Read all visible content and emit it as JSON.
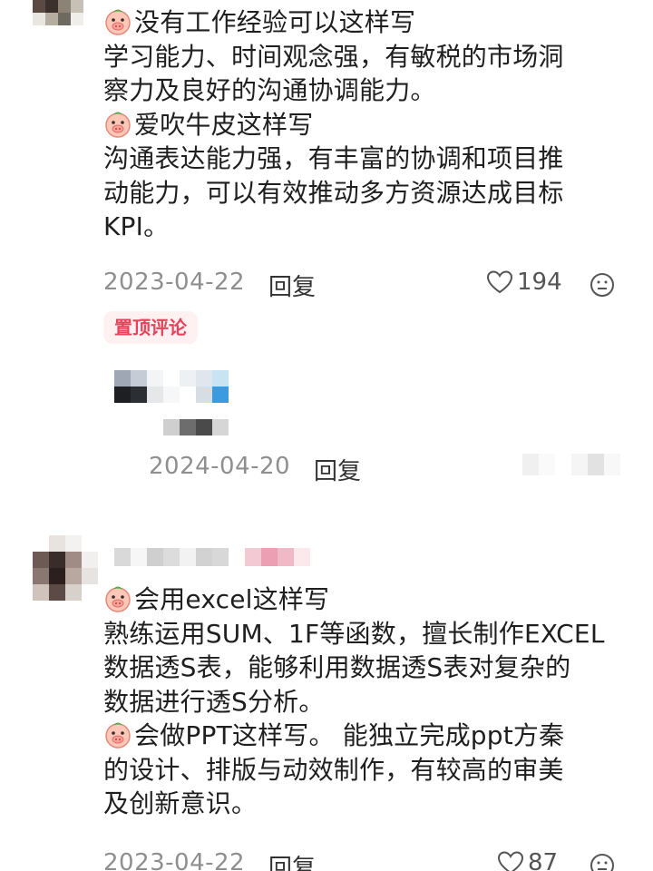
{
  "comment_1": {
    "lines": [
      {
        "emoji": "pig-face-icon",
        "text": "没有工作经验可以这样写"
      },
      {
        "text": "学习能力、时间观念强，有敏税的市场洞"
      },
      {
        "text": "察力及良好的沟通协调能力。"
      },
      {
        "emoji": "pig-face-icon",
        "text": "爱吹牛皮这样写"
      },
      {
        "text": "沟通表达能力强，有丰富的协调和项目推"
      },
      {
        "text": "动能力，可以有效推动多方资源达成目标"
      },
      {
        "text": "KPI。"
      }
    ],
    "date": "2023-04-22",
    "reply_label": "回复",
    "like_count": "194",
    "pinned_label": "置顶评论"
  },
  "reply_1": {
    "date": "2024-04-20",
    "reply_label": "回复"
  },
  "comment_2": {
    "lines": [
      {
        "emoji": "pig-face-icon",
        "text": "会用excel这样写"
      },
      {
        "text": "熟练运用SUM、1F等函数，擅长制作EXCEL"
      },
      {
        "text": "数据透S表，能够利用数据透S表对复杂的"
      },
      {
        "text": "数据进行透S分析。"
      },
      {
        "emoji": "pig-face-icon",
        "text": "会做PPT这样写。 能独立完成ppt方秦"
      },
      {
        "text": "的设计、排版与动效制作，有较高的审美"
      },
      {
        "text": "及创新意识。"
      }
    ],
    "date": "2023-04-22",
    "reply_label": "回复",
    "like_count": "87"
  },
  "colors": {
    "pin_badge_bg": "#fff0f2",
    "pin_badge_text": "#e8425a",
    "meta_gray": "#8f8f8f",
    "body_text": "#1f1f1f"
  }
}
